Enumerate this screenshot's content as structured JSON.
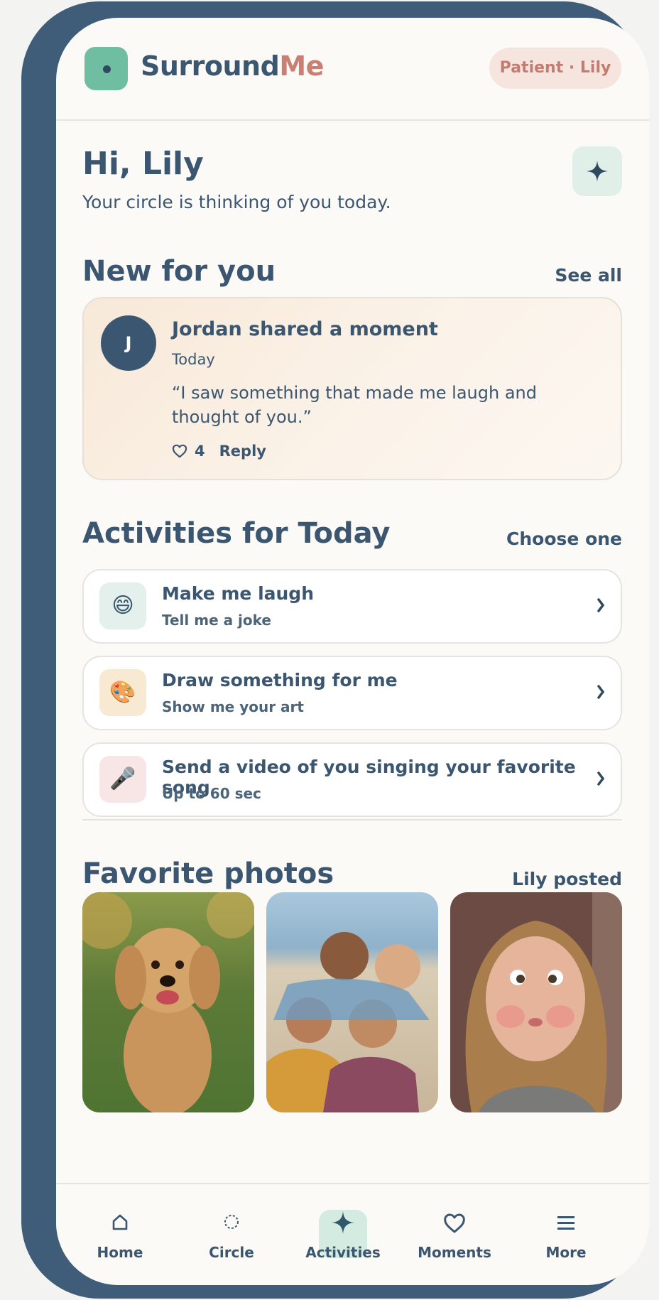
{
  "app": {
    "brand_part1": "Surround",
    "brand_part2": "Me",
    "role_pill": "Patient · Lily"
  },
  "greeting": {
    "title": "Hi, Lily",
    "subtitle": "Your circle is thinking of you today."
  },
  "new_for_you": {
    "title": "New for you",
    "link": "See all",
    "card": {
      "avatar_initial": "J",
      "title": "Jordan shared a moment",
      "date": "Today",
      "quote": "“I saw something that made me laugh and thought of you.”",
      "likes": "4",
      "reply_label": "Reply"
    }
  },
  "activities": {
    "title": "Activities for Today",
    "link": "Choose one",
    "items": [
      {
        "emoji": "😄",
        "title": "Make me laugh",
        "subtitle": "Tell me a joke",
        "icon_bg": "#e3f0ec"
      },
      {
        "emoji": "🎨",
        "title": "Draw something for me",
        "subtitle": "Show me your art",
        "icon_bg": "#f7e9d2"
      },
      {
        "emoji": "🎤",
        "title": "Send a video of you singing your favorite song",
        "subtitle": "Up to 60 sec",
        "icon_bg": "#f7e6e5"
      }
    ]
  },
  "photos": {
    "title": "Favorite photos",
    "link": "Lily posted"
  },
  "nav": {
    "home": "Home",
    "circle": "Circle",
    "activities": "Activities",
    "moments": "Moments",
    "more": "More"
  },
  "colors": {
    "primary": "#3b5670",
    "accent": "#c98073",
    "mint": "#6fbea2",
    "frame": "#3f5d78"
  }
}
